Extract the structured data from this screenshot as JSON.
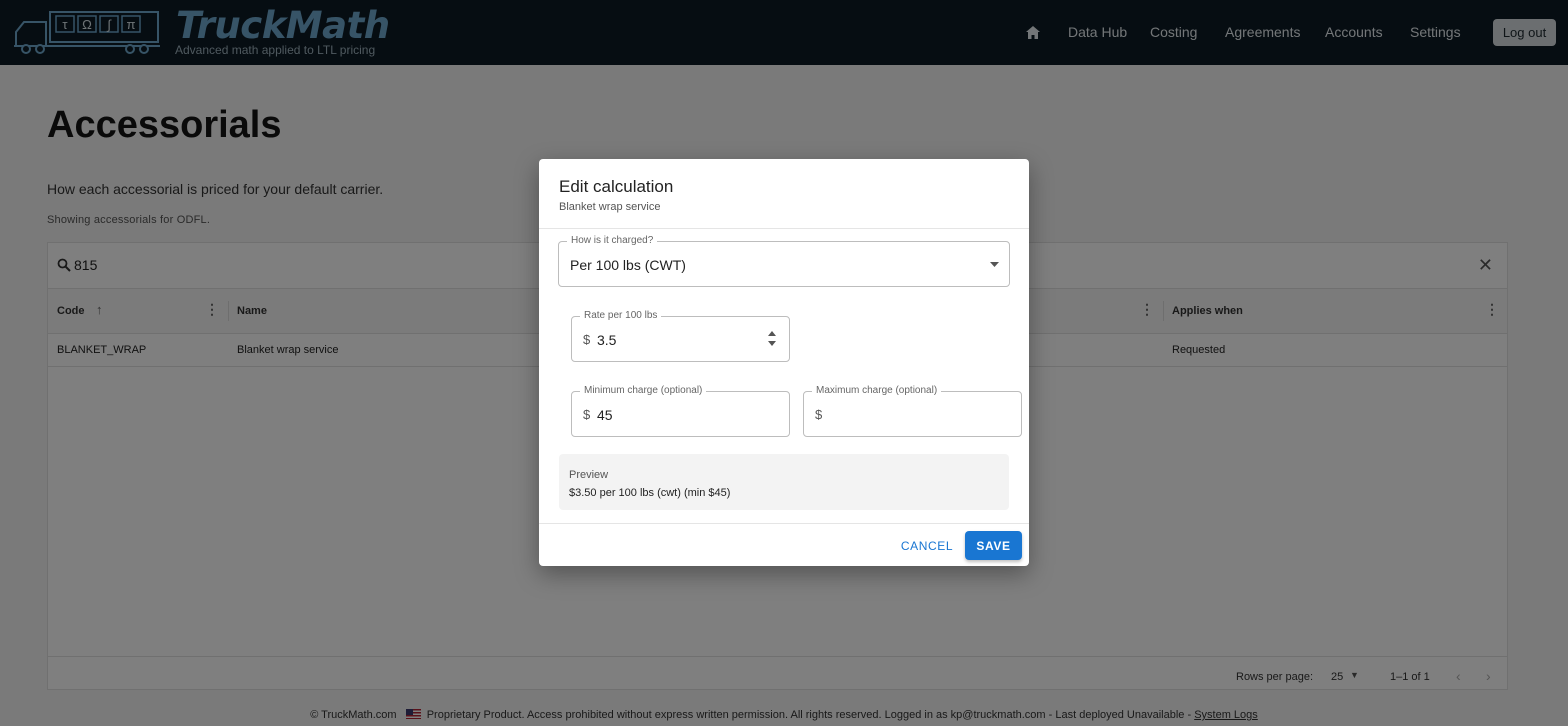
{
  "header": {
    "brand_name": "TruckMath",
    "brand_tagline": "Advanced math applied to LTL pricing",
    "logo_symbols": [
      "τ",
      "Ω",
      "∫",
      "π"
    ],
    "nav": [
      "Data Hub",
      "Costing",
      "Agreements",
      "Accounts",
      "Settings"
    ],
    "logout_label": "Log out"
  },
  "page": {
    "title": "Accessorials",
    "description": "How each accessorial is priced for your default carrier.",
    "note": "Showing accessorials for ODFL."
  },
  "grid": {
    "search_value": "815",
    "columns": [
      "Code",
      "Name",
      "Applies when"
    ],
    "rows": [
      {
        "code": "BLANKET_WRAP",
        "name": "Blanket wrap service",
        "applies_when": "Requested"
      }
    ],
    "rows_per_page_label": "Rows per page:",
    "rows_per_page_value": "25",
    "pagination_text": "1–1 of 1"
  },
  "footer": {
    "copyright": "© TruckMath.com",
    "notice": "Proprietary Product. Access prohibited without express written permission. All rights reserved. Logged in as kp@truckmath.com - Last deployed Unavailable - ",
    "link": "System Logs"
  },
  "dialog": {
    "title": "Edit calculation",
    "subtitle": "Blanket wrap service",
    "charge_label": "How is it charged?",
    "charge_value": "Per 100 lbs (CWT)",
    "rate_label": "Rate per 100 lbs",
    "rate_value": "3.5",
    "currency_prefix": "$",
    "min_label": "Minimum charge (optional)",
    "min_value": "45",
    "max_label": "Maximum charge (optional)",
    "max_value": "",
    "preview_label": "Preview",
    "preview_text": "$3.50 per 100 lbs (cwt) (min $45)",
    "cancel_label": "CANCEL",
    "save_label": "SAVE"
  },
  "colors": {
    "header_bg": "#0d1b24",
    "brand_blue": "#6fa9cf",
    "primary": "#1976d2"
  }
}
